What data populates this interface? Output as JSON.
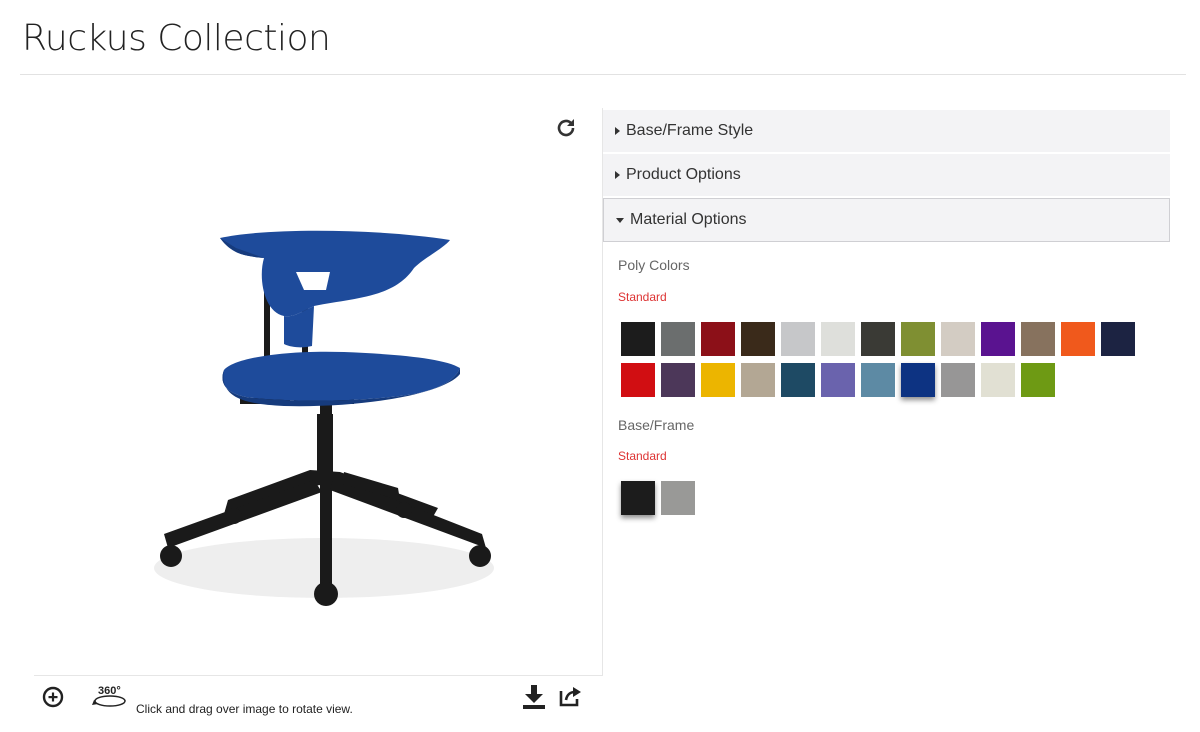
{
  "page": {
    "title": "Ruckus Collection"
  },
  "viewer": {
    "hint": "Click and drag over image to rotate view.",
    "spin_badge": "360°"
  },
  "accordion": [
    {
      "label": "Base/Frame Style",
      "open": false
    },
    {
      "label": "Product Options",
      "open": false
    },
    {
      "label": "Material Options",
      "open": true
    }
  ],
  "material": {
    "poly": {
      "label": "Poly Colors",
      "subtitle": "Standard",
      "colors": [
        "#1c1c1c",
        "#6b6e6e",
        "#8c1018",
        "#3a2a1a",
        "#c6c7c9",
        "#dedfdb",
        "#3a3a35",
        "#7f8f32",
        "#d3ccc3",
        "#5a1390",
        "#87725e",
        "#f0591c",
        "#1c2342",
        "#d10e12",
        "#4c3759",
        "#ecb500",
        "#b3a794",
        "#1e4a64",
        "#6a63ad",
        "#5d8aa4",
        "#0d3382",
        "#979696",
        "#e1e0d3",
        "#6e9a14"
      ],
      "selected_index": 20
    },
    "base": {
      "label": "Base/Frame",
      "subtitle": "Standard",
      "colors": [
        "#1c1c1c",
        "#999997"
      ],
      "selected_index": 0
    }
  },
  "colors": {
    "accent_red": "#dd3333",
    "chair_blue": "#1e4b9b",
    "frame": "#1a1a1a"
  }
}
